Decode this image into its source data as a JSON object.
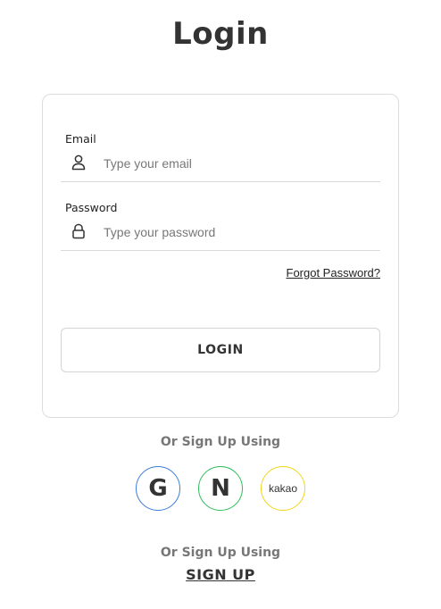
{
  "page": {
    "title": "Login"
  },
  "form": {
    "email": {
      "label": "Email",
      "placeholder": "Type your email",
      "value": "",
      "icon": "user-icon"
    },
    "password": {
      "label": "Password",
      "placeholder": "Type your password",
      "value": "",
      "icon": "lock-icon"
    },
    "forgot_label": "Forgot Password?",
    "login_label": "LOGIN"
  },
  "social": {
    "heading": "Or Sign Up Using",
    "providers": [
      {
        "id": "google",
        "glyph": "G",
        "color": "#3b7ddd"
      },
      {
        "id": "naver",
        "glyph": "N",
        "color": "#2dbf5b"
      },
      {
        "id": "kakao",
        "glyph": "kakao",
        "color": "#f2d61a"
      }
    ]
  },
  "signup": {
    "heading": "Or Sign Up Using",
    "label": "SIGN UP"
  }
}
